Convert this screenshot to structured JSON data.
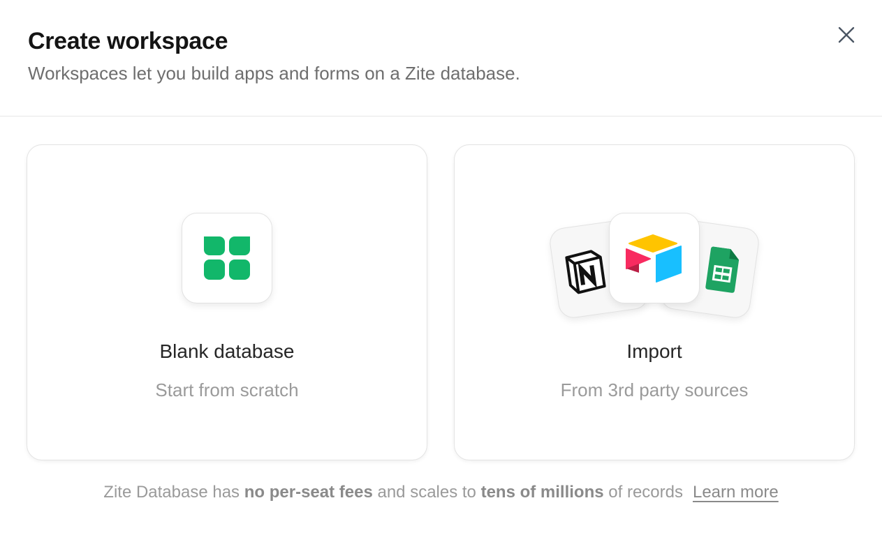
{
  "header": {
    "title": "Create workspace",
    "subtitle": "Workspaces let you build apps and forms on a Zite database."
  },
  "close": {
    "icon": "close-icon"
  },
  "options": {
    "blank": {
      "title": "Blank database",
      "subtitle": "Start from scratch",
      "icon": "grid-table-icon",
      "icon_color": "#12b76a"
    },
    "import": {
      "title": "Import",
      "subtitle": "From 3rd party sources",
      "icons": [
        "notion-logo",
        "airtable-logo",
        "google-sheets-logo"
      ]
    }
  },
  "footer": {
    "text_1": "Zite Database has ",
    "bold_1": "no per-seat fees",
    "text_2": " and scales to ",
    "bold_2": "tens of millions",
    "text_3": " of records",
    "link": "Learn more"
  }
}
